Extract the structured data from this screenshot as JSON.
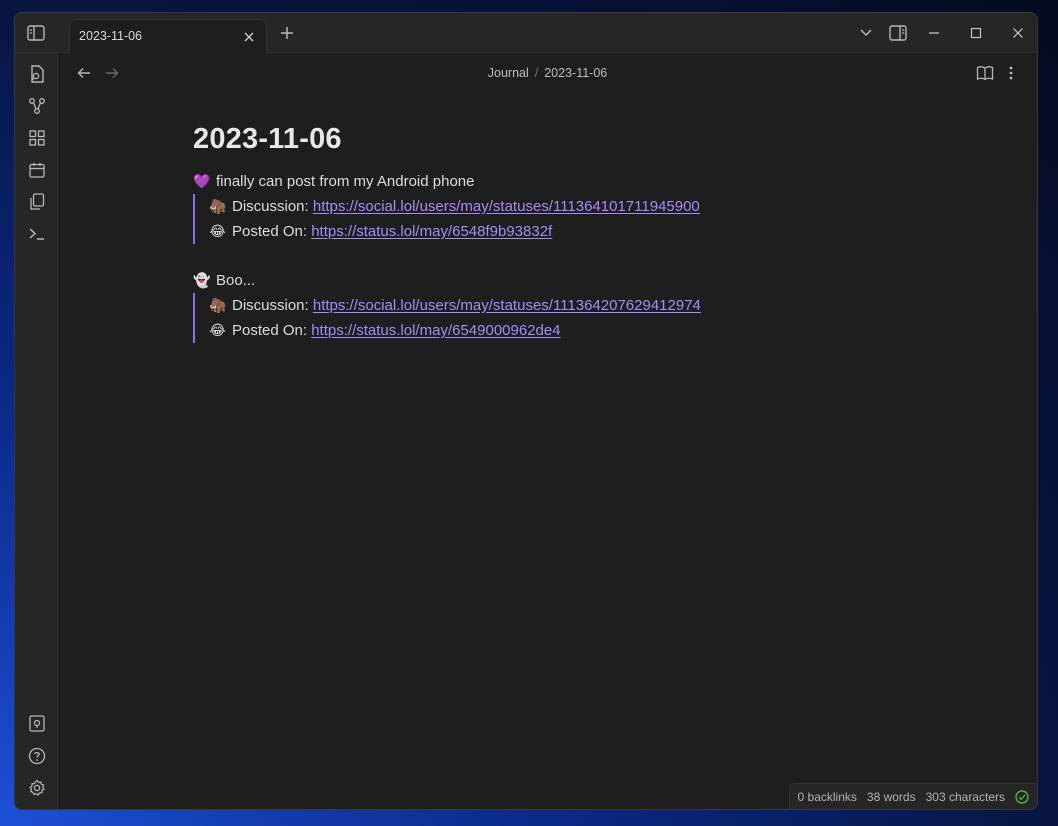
{
  "tab": {
    "title": "2023-11-06"
  },
  "breadcrumb": {
    "folder": "Journal",
    "separator": "/",
    "note": "2023-11-06"
  },
  "note": {
    "title": "2023-11-06",
    "entries": [
      {
        "emoji": "💜",
        "text": "finally can post from my Android phone",
        "discussion_emoji": "🦣",
        "discussion_label": "Discussion: ",
        "discussion_url": "https://social.lol/users/may/statuses/111364101711945900",
        "posted_emoji": "😂",
        "posted_label": "Posted On: ",
        "posted_url": "https://status.lol/may/6548f9b93832f"
      },
      {
        "emoji": "👻",
        "text": "Boo...",
        "discussion_emoji": "🦣",
        "discussion_label": "Discussion: ",
        "discussion_url": "https://social.lol/users/may/statuses/111364207629412974",
        "posted_emoji": "😂",
        "posted_label": "Posted On: ",
        "posted_url": "https://status.lol/may/6549000962de4"
      }
    ]
  },
  "status": {
    "backlinks": "0 backlinks",
    "words": "38 words",
    "characters": "303 characters"
  },
  "colors": {
    "accent": "#8f6ee9",
    "link": "#a88bfa",
    "sync_ok": "#4caf50"
  }
}
